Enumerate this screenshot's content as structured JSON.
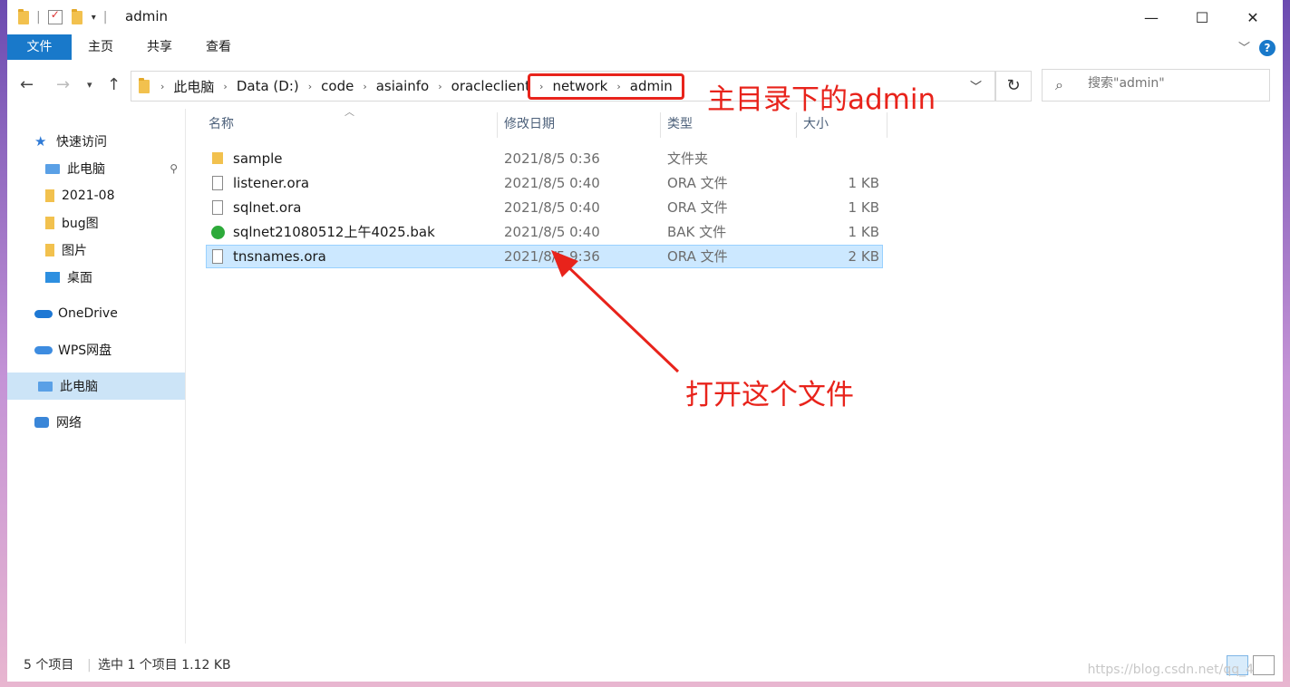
{
  "window": {
    "title": "admin",
    "controls": {
      "minimize": "—",
      "maximize": "☐",
      "close": "✕"
    }
  },
  "ribbon": {
    "tabs": [
      "文件",
      "主页",
      "共享",
      "查看"
    ],
    "help": "?"
  },
  "address": {
    "segments": [
      "此电脑",
      "Data (D:)",
      "code",
      "asiainfo",
      "oracleclient",
      "network",
      "admin"
    ]
  },
  "search": {
    "placeholder": "搜索\"admin\""
  },
  "annotations": {
    "path_note": "主目录下的admin",
    "file_note": "打开这个文件"
  },
  "sidebar": {
    "items": [
      {
        "label": "快速访问",
        "icon": "star-icon"
      },
      {
        "label": "此电脑",
        "icon": "computer-icon"
      },
      {
        "label": "2021-08",
        "icon": "folder-icon"
      },
      {
        "label": "bug图",
        "icon": "folder-icon"
      },
      {
        "label": "图片",
        "icon": "folder-icon"
      },
      {
        "label": "桌面",
        "icon": "desktop-icon"
      },
      {
        "label": "OneDrive",
        "icon": "cloud-icon"
      },
      {
        "label": "WPS网盘",
        "icon": "cloud-icon"
      },
      {
        "label": "此电脑",
        "icon": "computer-icon"
      },
      {
        "label": "网络",
        "icon": "network-icon"
      }
    ]
  },
  "table": {
    "headers": [
      "名称",
      "修改日期",
      "类型",
      "大小"
    ],
    "rows": [
      {
        "name": "sample",
        "date": "2021/8/5 0:36",
        "type": "文件夹",
        "size": "",
        "icon": "folder-icon"
      },
      {
        "name": "listener.ora",
        "date": "2021/8/5 0:40",
        "type": "ORA 文件",
        "size": "1 KB",
        "icon": "file-icon"
      },
      {
        "name": "sqlnet.ora",
        "date": "2021/8/5 0:40",
        "type": "ORA 文件",
        "size": "1 KB",
        "icon": "file-icon"
      },
      {
        "name": "sqlnet21080512上午4025.bak",
        "date": "2021/8/5 0:40",
        "type": "BAK 文件",
        "size": "1 KB",
        "icon": "bak-file-icon"
      },
      {
        "name": "tnsnames.ora",
        "date": "2021/8/5 9:36",
        "type": "ORA 文件",
        "size": "2 KB",
        "icon": "file-icon"
      }
    ]
  },
  "status": {
    "count": "5 个项目",
    "selection": "选中 1 个项目  1.12 KB"
  },
  "watermark": "https://blog.csdn.net/qq_4"
}
